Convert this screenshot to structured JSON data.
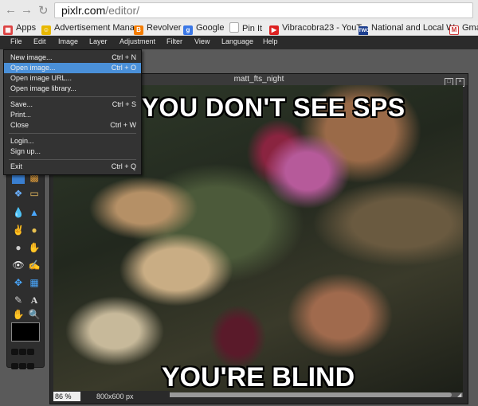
{
  "browser": {
    "back_icon": "back-arrow-icon",
    "forward_icon": "forward-arrow-icon",
    "reload_icon": "reload-icon",
    "url_host": "pixlr.com",
    "url_path": "/editor/",
    "bookmarks": [
      {
        "label": "Apps",
        "icon": "apps-grid-icon"
      },
      {
        "label": "Advertisement Mana",
        "icon": "smiley-icon"
      },
      {
        "label": "Revolver",
        "icon": "blogger-icon"
      },
      {
        "label": "Google",
        "icon": "google-icon"
      },
      {
        "label": "Pin It",
        "icon": "page-icon"
      },
      {
        "label": "Vibracobra23 - YouT",
        "icon": "youtube-icon"
      },
      {
        "label": "National and Local W",
        "icon": "twc-icon"
      },
      {
        "label": "Gmail",
        "icon": "gmail-icon"
      }
    ]
  },
  "menubar": {
    "items": [
      "File",
      "Edit",
      "Image",
      "Layer",
      "Adjustment",
      "Filter",
      "View",
      "Language",
      "Help"
    ]
  },
  "file_menu": {
    "items": [
      {
        "label": "New image...",
        "shortcut": "Ctrl + N"
      },
      {
        "label": "Open image...",
        "shortcut": "Ctrl + O",
        "selected": true
      },
      {
        "label": "Open image URL...",
        "shortcut": ""
      },
      {
        "label": "Open image library...",
        "shortcut": ""
      },
      {
        "label": "Save...",
        "shortcut": "Ctrl + S"
      },
      {
        "label": "Print...",
        "shortcut": ""
      },
      {
        "label": "Close",
        "shortcut": "Ctrl + W"
      },
      {
        "label": "Login...",
        "shortcut": ""
      },
      {
        "label": "Sign up...",
        "shortcut": ""
      },
      {
        "label": "Exit",
        "shortcut": "Ctrl + Q"
      }
    ]
  },
  "image_window": {
    "title": "matt_fts_night",
    "meme_top": "IF YOU DON'T SEE SPS",
    "meme_bottom": "YOU'RE BLIND",
    "zoom": "86",
    "zoom_unit": "%",
    "size": "800x600 px"
  },
  "colors": {
    "menu_highlight": "#4a90d9",
    "primary_color": "#000000"
  }
}
